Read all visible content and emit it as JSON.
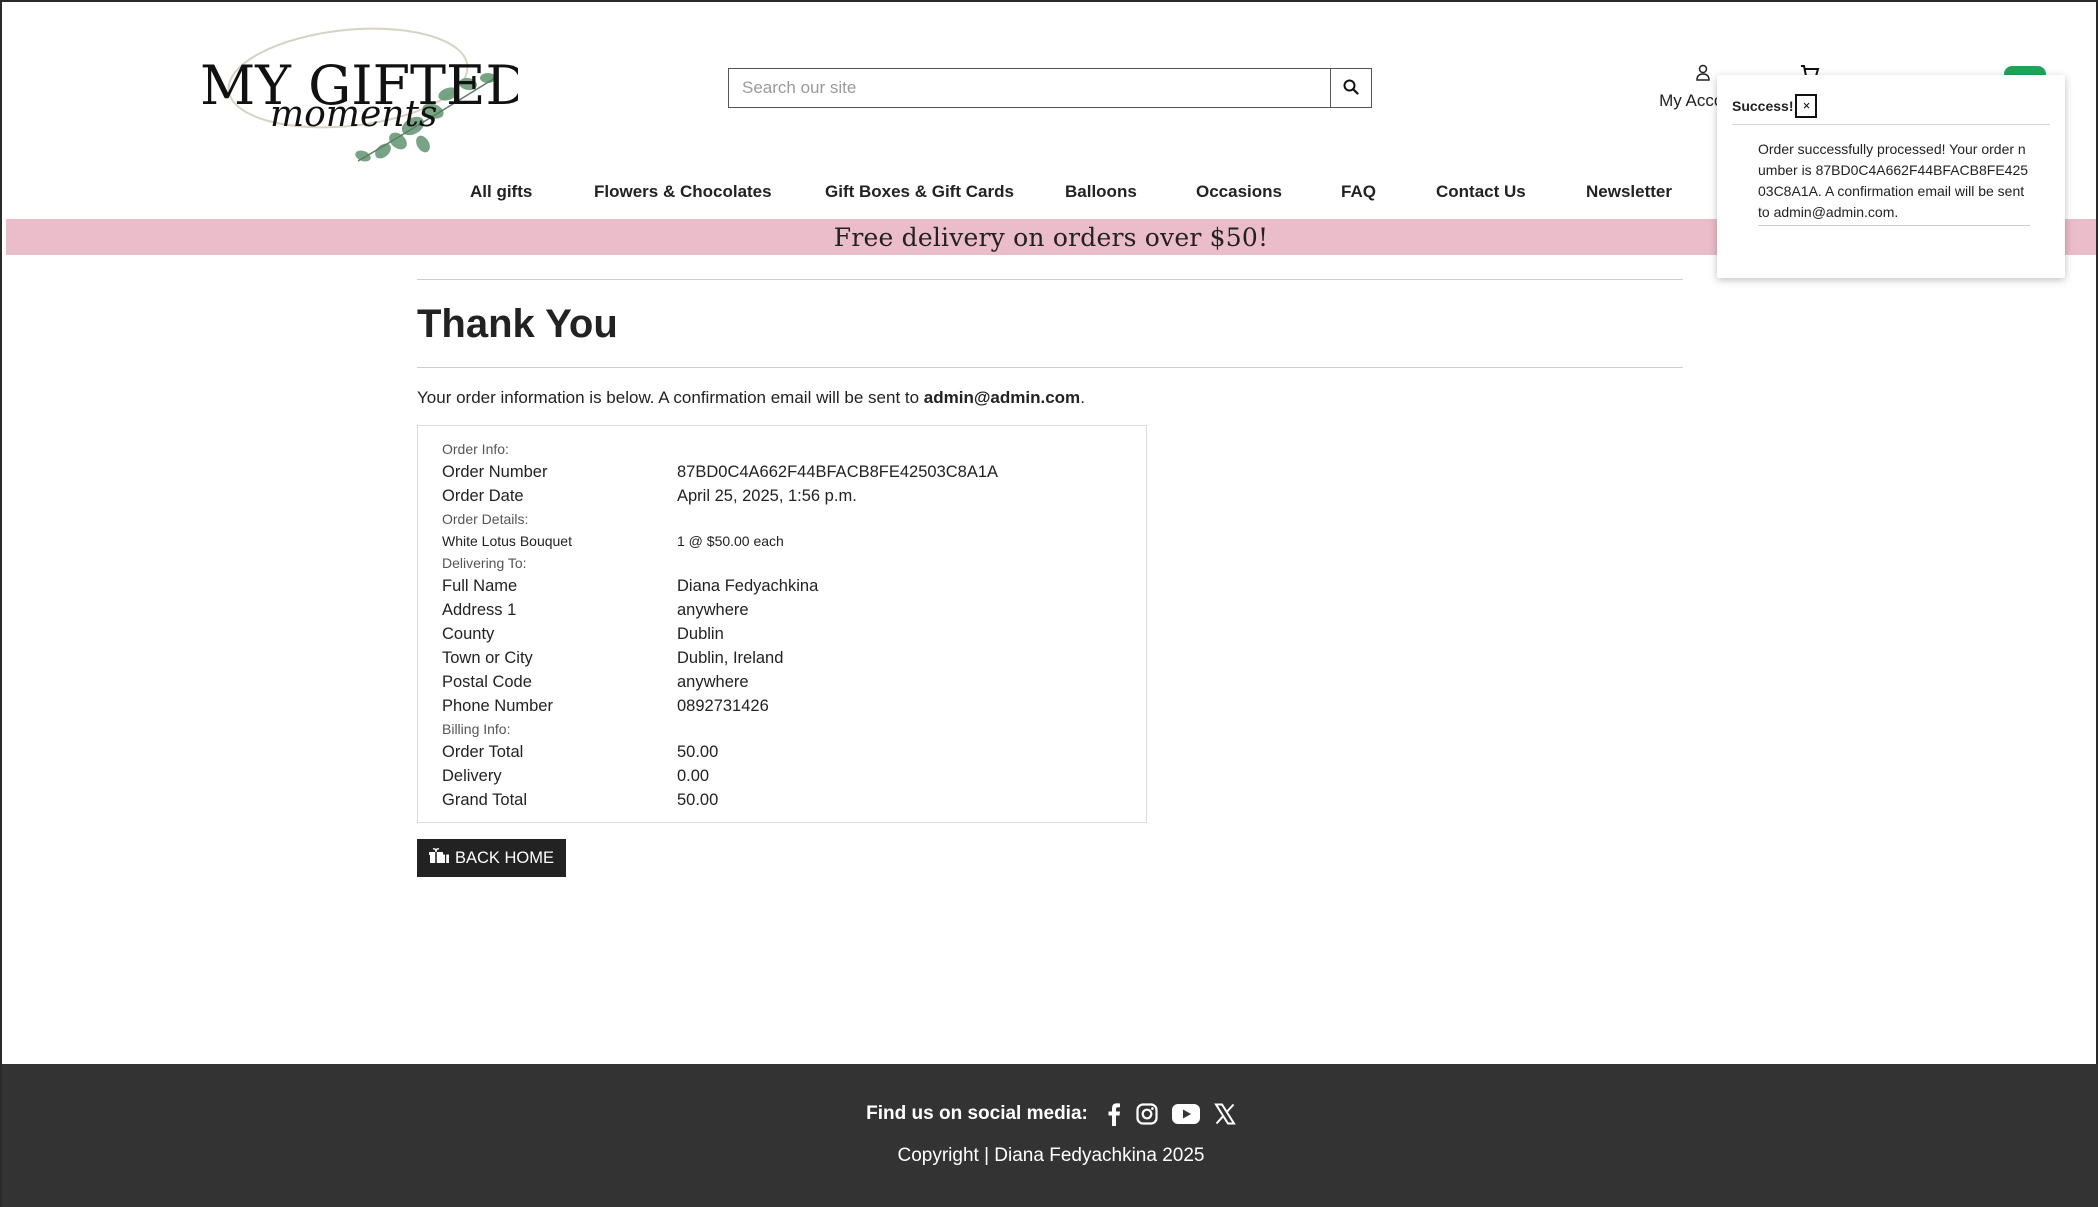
{
  "header": {
    "logo_text_top": "MY GIFTED",
    "logo_text_script": "moments",
    "search_placeholder": "Search our site",
    "account_label": "My Account"
  },
  "nav": {
    "items": [
      "All gifts",
      "Flowers & Chocolates",
      "Gift Boxes & Gift Cards",
      "Balloons",
      "Occasions",
      "FAQ",
      "Contact Us",
      "Newsletter"
    ]
  },
  "banner": {
    "text": "Free delivery on orders over $50!"
  },
  "main": {
    "title": "Thank You",
    "intro_text": "Your order information is below. A confirmation email will be sent to ",
    "intro_email": "admin@admin.com",
    "intro_end": ".",
    "order_info_label": "Order Info:",
    "order_number_label": "Order Number",
    "order_number": "87BD0C4A662F44BFACB8FE42503C8A1A",
    "order_date_label": "Order Date",
    "order_date": "April 25, 2025, 1:56 p.m.",
    "order_details_label": "Order Details:",
    "item_name": "White Lotus Bouquet",
    "item_qty": "1 @ $50.00 each",
    "delivering_label": "Delivering To:",
    "full_name_label": "Full Name",
    "full_name": "Diana Fedyachkina",
    "address1_label": "Address 1",
    "address1": "anywhere",
    "county_label": "County",
    "county": "Dublin",
    "town_label": "Town or City",
    "town": "Dublin, Ireland",
    "postal_label": "Postal Code",
    "postal": "anywhere",
    "phone_label": "Phone Number",
    "phone": "0892731426",
    "billing_label": "Billing Info:",
    "order_total_label": "Order Total",
    "order_total": "50.00",
    "delivery_label": "Delivery",
    "delivery": "0.00",
    "grand_total_label": "Grand Total",
    "grand_total": "50.00",
    "back_button": "BACK HOME"
  },
  "toast": {
    "title": "Success!",
    "close": "×",
    "message": "Order successfully processed! Your order number is 87BD0C4A662F44BFACB8FE42503C8A1A. A confirmation email will be sent to admin@admin.com."
  },
  "footer": {
    "social_label": "Find us on social media:",
    "copyright": "Copyright | Diana Fedyachkina 2025"
  },
  "colors": {
    "banner": "#ebbcc9",
    "footer": "#333333",
    "button": "#222222",
    "cart_accent": "#1fa55a"
  },
  "icons": [
    "search-icon",
    "user-icon",
    "cart-icon",
    "gift-icon",
    "facebook-icon",
    "instagram-icon",
    "youtube-icon",
    "x-icon"
  ]
}
